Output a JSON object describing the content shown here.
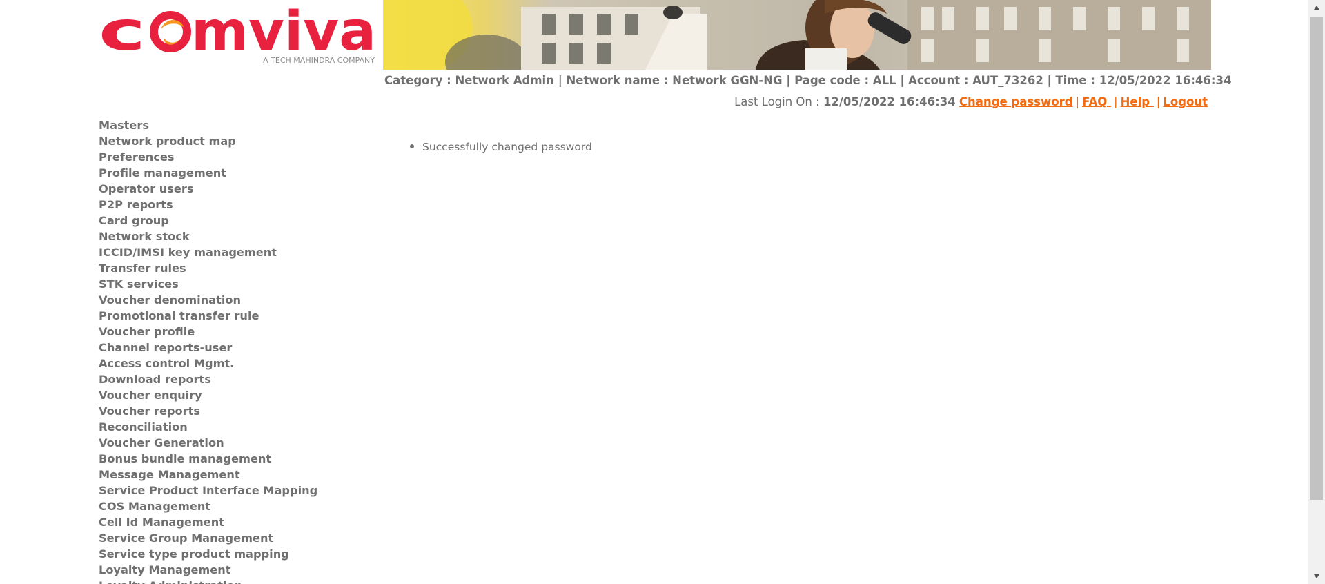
{
  "logo": {
    "brand": "comviva",
    "tagline": "A TECH MAHINDRA COMPANY"
  },
  "header": {
    "info": "Category : Network Admin | Network name : Network GGN-NG | Page code : ALL | Account : AUT_73262 | Time : 12/05/2022 16:46:34",
    "last_login_label": "Last Login On : ",
    "last_login_value": "12/05/2022 16:46:34",
    "links": {
      "change_password": "Change password",
      "faq": "FAQ ",
      "help": "Help ",
      "logout": "Logout"
    },
    "separator": "|"
  },
  "sidebar": {
    "items": [
      {
        "label": "Masters"
      },
      {
        "label": "Network product map"
      },
      {
        "label": "Preferences"
      },
      {
        "label": "Profile management"
      },
      {
        "label": "Operator users"
      },
      {
        "label": "P2P reports"
      },
      {
        "label": "Card group"
      },
      {
        "label": "Network stock"
      },
      {
        "label": "ICCID/IMSI key management"
      },
      {
        "label": "Transfer rules"
      },
      {
        "label": "STK services"
      },
      {
        "label": "Voucher denomination"
      },
      {
        "label": "Promotional transfer rule"
      },
      {
        "label": "Voucher profile"
      },
      {
        "label": "Channel reports-user"
      },
      {
        "label": "Access control Mgmt."
      },
      {
        "label": "Download reports"
      },
      {
        "label": "Voucher enquiry"
      },
      {
        "label": "Voucher reports"
      },
      {
        "label": "Reconciliation"
      },
      {
        "label": "Voucher Generation"
      },
      {
        "label": "Bonus bundle management"
      },
      {
        "label": "Message Management"
      },
      {
        "label": "Service Product Interface Mapping"
      },
      {
        "label": "COS Management"
      },
      {
        "label": "Cell Id Management"
      },
      {
        "label": "Service Group Management"
      },
      {
        "label": "Service type product mapping"
      },
      {
        "label": "Loyalty Management"
      },
      {
        "label": "Loyalty Administration"
      }
    ]
  },
  "main": {
    "messages": [
      "Successfully changed password"
    ]
  },
  "colors": {
    "brand_red": "#e8213f",
    "brand_orange": "#f7941d",
    "link_orange": "#f26b10",
    "text_gray": "#707070"
  }
}
